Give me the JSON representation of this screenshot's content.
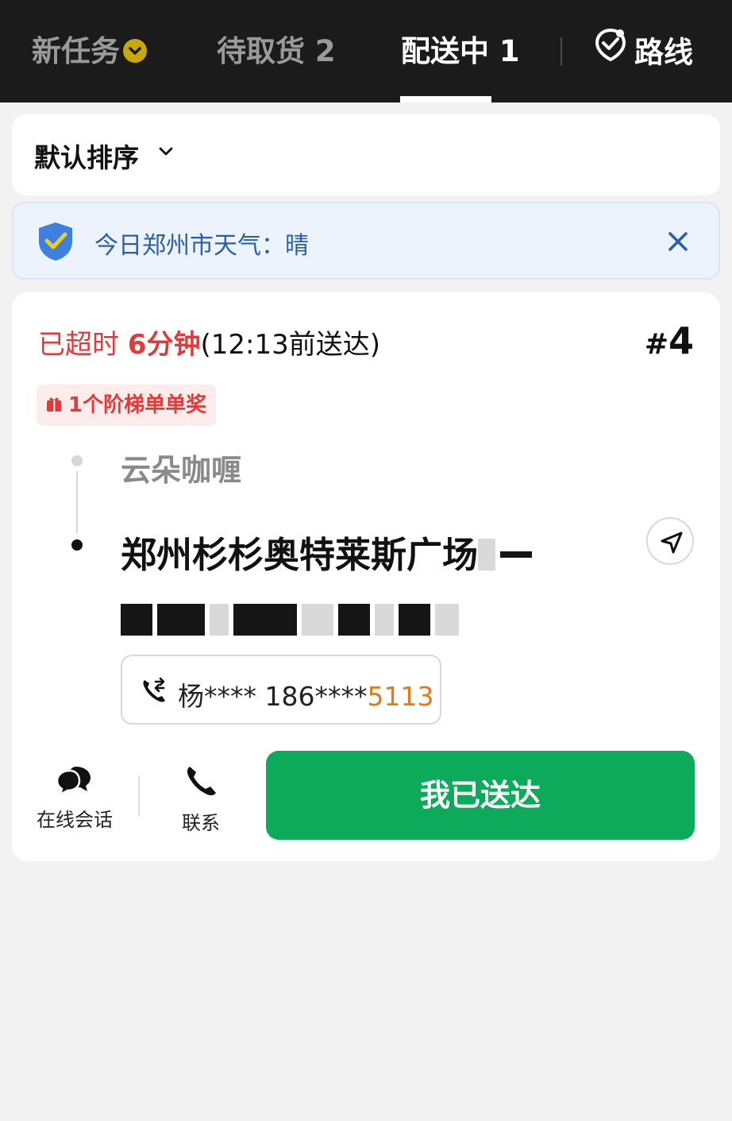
{
  "tabs": {
    "new_task": "新任务",
    "pickup": "待取货",
    "pickup_count": "2",
    "delivering": "配送中",
    "delivering_count": "1",
    "route": "路线"
  },
  "sort": {
    "label": "默认排序"
  },
  "weather": {
    "text": "今日郑州市天气：晴"
  },
  "order": {
    "overdue_prefix": "已超时",
    "overdue_time": "6分钟",
    "deadline": "(12:13前送达)",
    "number_hash": "#",
    "number": "4",
    "reward": "1个阶梯单单奖",
    "shop_name": "云朵咖喱",
    "address": "郑州杉杉奥特莱斯广场",
    "phone_name": "杨****",
    "phone_masked": "186****",
    "phone_tail": "5113"
  },
  "actions": {
    "chat": "在线会话",
    "call": "联系",
    "delivered": "我已送达"
  },
  "colors": {
    "accent_green": "#0eaa5b",
    "overdue_red": "#e23a3a",
    "phone_orange": "#e07a1a",
    "nav_bg": "#1b1b1b",
    "weather_blue": "#2b5ea8"
  }
}
